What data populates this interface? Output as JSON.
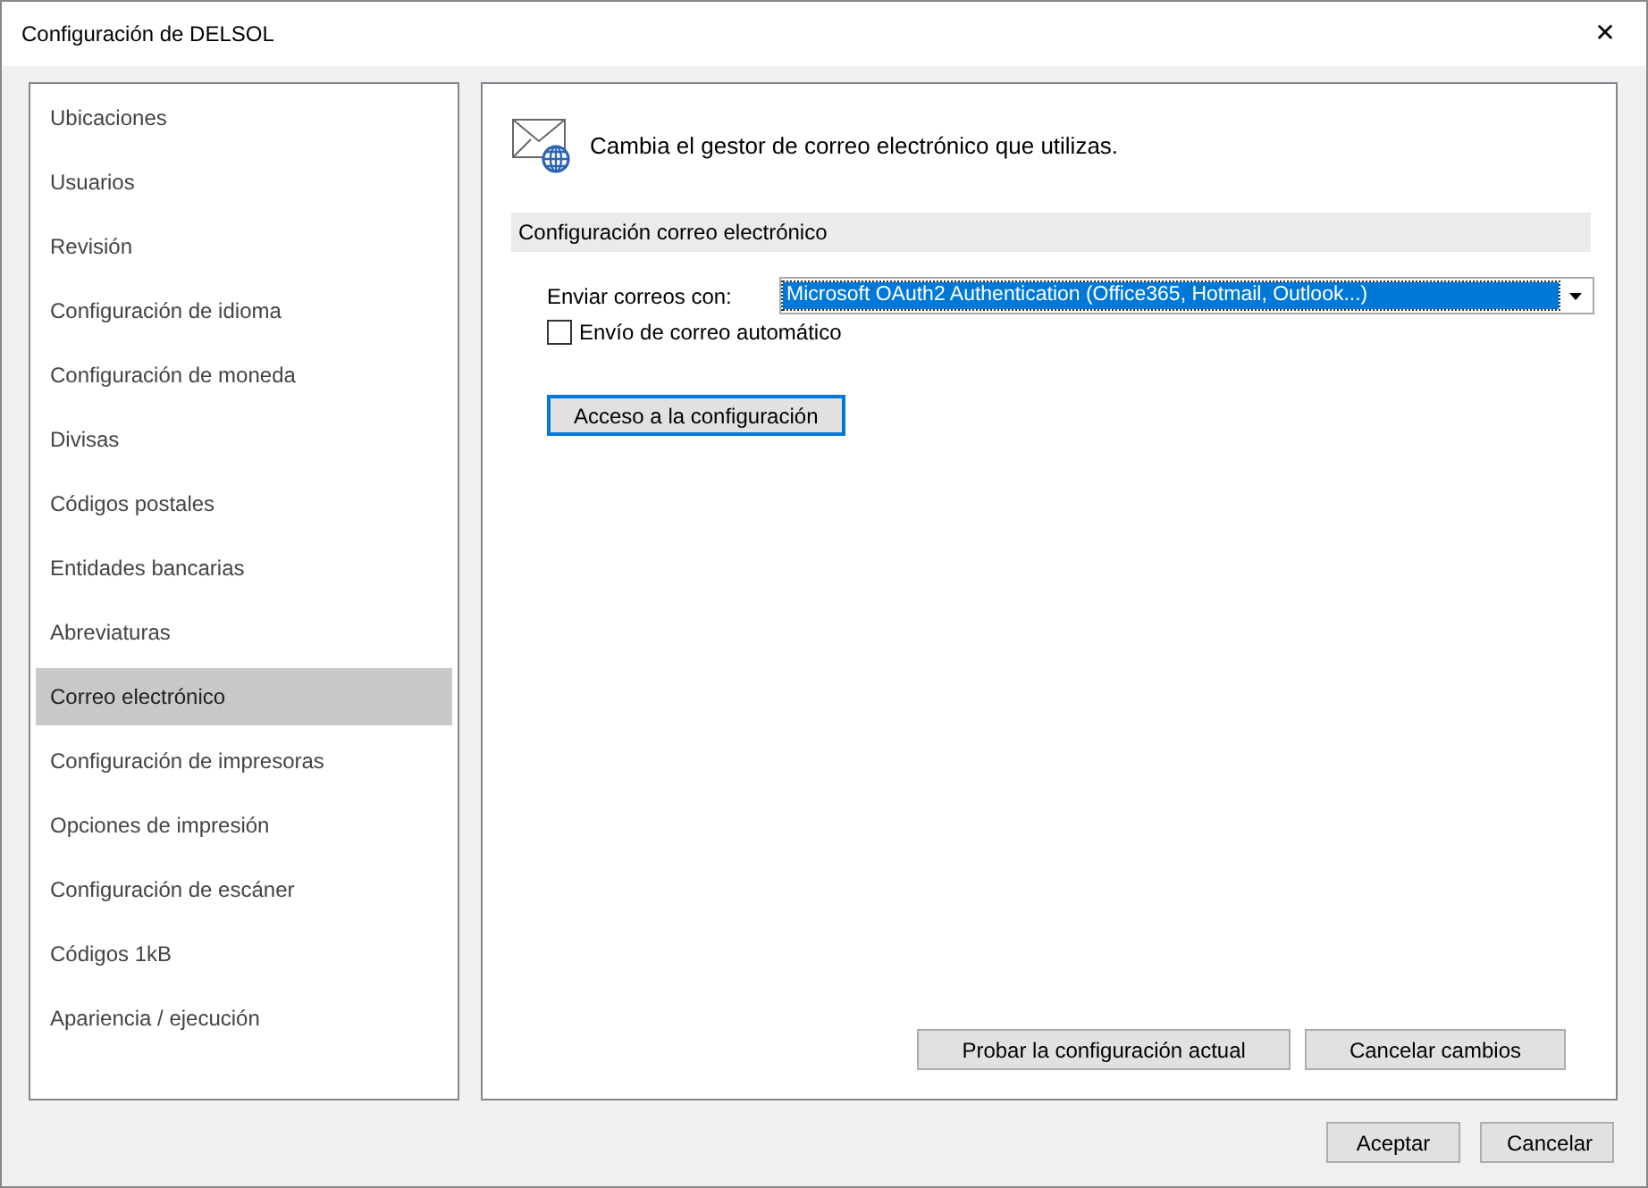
{
  "window": {
    "title": "Configuración de DELSOL",
    "close": "✕"
  },
  "sidebar": {
    "items": [
      {
        "label": "Ubicaciones",
        "selected": false
      },
      {
        "label": "Usuarios",
        "selected": false
      },
      {
        "label": "Revisión",
        "selected": false
      },
      {
        "label": "Configuración de idioma",
        "selected": false
      },
      {
        "label": "Configuración de moneda",
        "selected": false
      },
      {
        "label": "Divisas",
        "selected": false
      },
      {
        "label": "Códigos postales",
        "selected": false
      },
      {
        "label": "Entidades bancarias",
        "selected": false
      },
      {
        "label": "Abreviaturas",
        "selected": false
      },
      {
        "label": "Correo electrónico",
        "selected": true
      },
      {
        "label": "Configuración de impresoras",
        "selected": false
      },
      {
        "label": "Opciones de impresión",
        "selected": false
      },
      {
        "label": "Configuración de escáner",
        "selected": false
      },
      {
        "label": "Códigos 1kB",
        "selected": false
      },
      {
        "label": "Apariencia / ejecución",
        "selected": false
      }
    ]
  },
  "panel": {
    "heading": "Cambia el gestor de correo electrónico que utilizas.",
    "section": "Configuración correo electrónico",
    "send_with": {
      "label": "Enviar correos con:",
      "value": "Microsoft OAuth2 Authentication (Office365, Hotmail, Outlook...)"
    },
    "auto_send": {
      "label": "Envío de correo automático",
      "checked": false
    },
    "config_button": "Acceso a la configuración",
    "buttons": [
      "Probar la configuración actual",
      "Cancelar cambios"
    ]
  },
  "footer": {
    "buttons": [
      "Aceptar",
      "Cancelar"
    ]
  }
}
